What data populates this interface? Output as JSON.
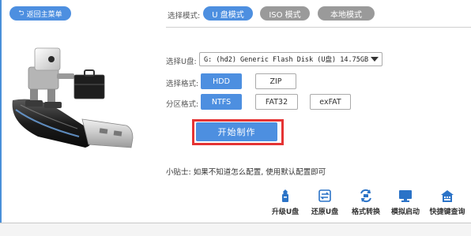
{
  "header": {
    "back_label": "返回主菜单",
    "mode_label": "选择模式:",
    "modes": [
      {
        "label": "U 盘模式",
        "active": true
      },
      {
        "label": "ISO 模式",
        "active": false
      },
      {
        "label": "本地模式",
        "active": false
      }
    ]
  },
  "form": {
    "usb_label": "选择U盘:",
    "usb_value": "G: (hd2) Generic Flash Disk  (U盘) 14.75GB",
    "format_label": "选择格式:",
    "formats": [
      {
        "label": "HDD",
        "active": true
      },
      {
        "label": "ZIP",
        "active": false
      }
    ],
    "partition_label": "分区格式:",
    "partitions": [
      {
        "label": "NTFS",
        "active": true
      },
      {
        "label": "FAT32",
        "active": false
      },
      {
        "label": "exFAT",
        "active": false
      }
    ],
    "start_label": "开始制作"
  },
  "tip": "小贴士: 如果不知道怎么配置, 使用默认配置即可",
  "tools": [
    {
      "label": "升级U盘",
      "icon": "usb-upgrade-icon"
    },
    {
      "label": "还原U盘",
      "icon": "usb-restore-icon"
    },
    {
      "label": "格式转换",
      "icon": "format-convert-icon"
    },
    {
      "label": "模拟启动",
      "icon": "monitor-icon"
    },
    {
      "label": "快捷键查询",
      "icon": "shortcut-query-icon"
    }
  ],
  "colors": {
    "accent": "#4d8fe0",
    "inactive": "#9a9a9a",
    "highlight_frame": "#e53434"
  }
}
